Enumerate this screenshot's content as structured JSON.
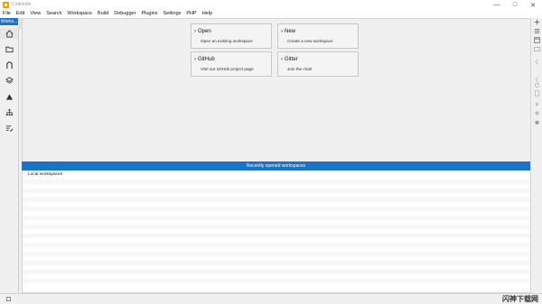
{
  "window": {
    "title": "Codelobe",
    "controls": {
      "minimize": "—",
      "maximize": "□",
      "close": "✕"
    }
  },
  "menubar": {
    "items": [
      "File",
      "Edit",
      "View",
      "Search",
      "Workspace",
      "Build",
      "Debugger",
      "Plugins",
      "Settings",
      "PHP",
      "Help"
    ]
  },
  "leftbar": {
    "tab_label": "Works...",
    "icons": [
      "home-icon",
      "folder-icon",
      "magnet-icon",
      "layers-icon",
      "triangle-icon",
      "sitemap-icon",
      "edit-list-icon"
    ]
  },
  "main": {
    "cards": [
      {
        "title": "Open",
        "subtitle": "Open an existing workspace"
      },
      {
        "title": "New",
        "subtitle": "Create a new workspace"
      },
      {
        "title": "GitHub",
        "subtitle": "Visit our GitHub project page"
      },
      {
        "title": "Gitter",
        "subtitle": "Join the chat!"
      }
    ],
    "recent": {
      "header": "Recently opened workspaces",
      "group_label": "Local workspaces"
    }
  },
  "rightbar": {
    "icons": [
      "plus-icon",
      "list-icon",
      "window-icon",
      "collapse-icon",
      "back-icon",
      "record-icon",
      "file-icon",
      "play-icon",
      "stop-icon",
      "bug-icon"
    ]
  },
  "statusbar": {
    "watermark": "闪神下载网"
  },
  "colors": {
    "accent": "#1a73c6",
    "background": "#f0f0f0"
  }
}
